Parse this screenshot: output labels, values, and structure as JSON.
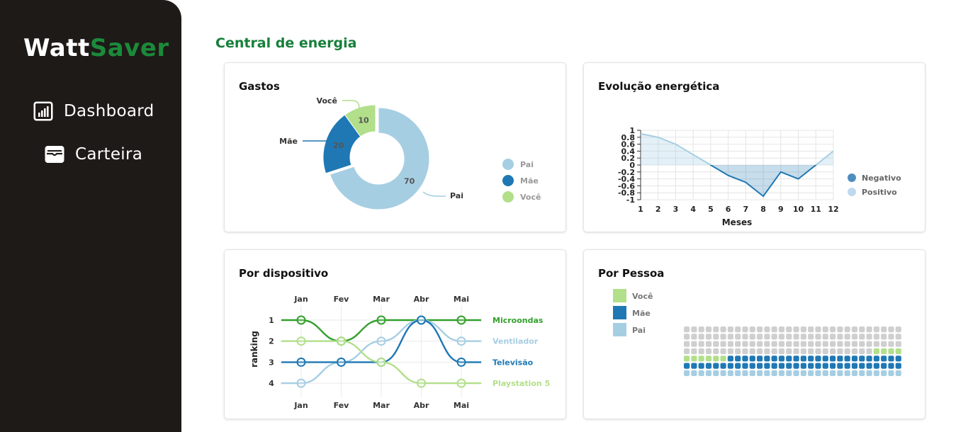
{
  "app": {
    "name_part1": "Watt",
    "name_part2": "Saver"
  },
  "nav": [
    {
      "label": "Dashboard",
      "icon": "bar-chart-icon"
    },
    {
      "label": "Carteira",
      "icon": "wallet-icon"
    }
  ],
  "page_title": "Central de energia",
  "colors": {
    "accent": "#16803a",
    "pai": "#a6cee3",
    "mae": "#1f78b4",
    "voce": "#b2df8a",
    "micro": "#33a02c",
    "sidebar": "#1e1a17"
  },
  "cards": {
    "gastos": {
      "title": "Gastos"
    },
    "evolucao": {
      "title": "Evolução energética"
    },
    "dispositivo": {
      "title": "Por dispositivo"
    },
    "pessoa": {
      "title": "Por Pessoa"
    }
  },
  "chart_data": [
    {
      "type": "pie",
      "title": "Gastos",
      "categories": [
        "Pai",
        "Mãe",
        "Você"
      ],
      "values": [
        70,
        20,
        10
      ],
      "legend": [
        "Pai",
        "Mãe",
        "Você"
      ],
      "legend_position": "right"
    },
    {
      "type": "area",
      "title": "Evolução energética",
      "xlabel": "Meses",
      "ylabel": "",
      "x": [
        1,
        2,
        3,
        4,
        5,
        6,
        7,
        8,
        9,
        10,
        11,
        12
      ],
      "y": [
        0.9,
        0.8,
        0.6,
        0.3,
        0.0,
        -0.3,
        -0.5,
        -0.9,
        -0.2,
        -0.4,
        0.0,
        0.4
      ],
      "xlim": [
        1,
        12
      ],
      "ylim": [
        -1,
        1
      ],
      "yticks": [
        "1",
        "0.8",
        "0.6",
        "0.4",
        "0.2",
        "0",
        "-0.2",
        "-0.4",
        "-0.6",
        "-0.8",
        "-1"
      ],
      "legend": [
        "Negativo",
        "Positivo"
      ],
      "legend_position": "right",
      "grid": true
    },
    {
      "type": "line",
      "title": "Por dispositivo",
      "ylabel": "ranking",
      "categories": [
        "Jan",
        "Fev",
        "Mar",
        "Abr",
        "Mai"
      ],
      "yticks": [
        "1",
        "2",
        "3",
        "4"
      ],
      "series": [
        {
          "name": "Microondas",
          "values": [
            1,
            2,
            1,
            1,
            1
          ]
        },
        {
          "name": "Ventilador",
          "values": [
            4,
            3,
            2,
            1,
            2
          ]
        },
        {
          "name": "Televisão",
          "values": [
            3,
            3,
            3,
            1,
            3
          ]
        },
        {
          "name": "Playstation 5",
          "values": [
            2,
            2,
            3,
            4,
            4
          ]
        }
      ]
    },
    {
      "type": "heatmap",
      "title": "Por Pessoa",
      "legend": [
        "Você",
        "Mãe",
        "Pai"
      ],
      "columns": 30,
      "rows": 7,
      "counts": {
        "Você": 10,
        "Mãe": 54,
        "Pai": 30,
        "empty": 116
      }
    }
  ]
}
